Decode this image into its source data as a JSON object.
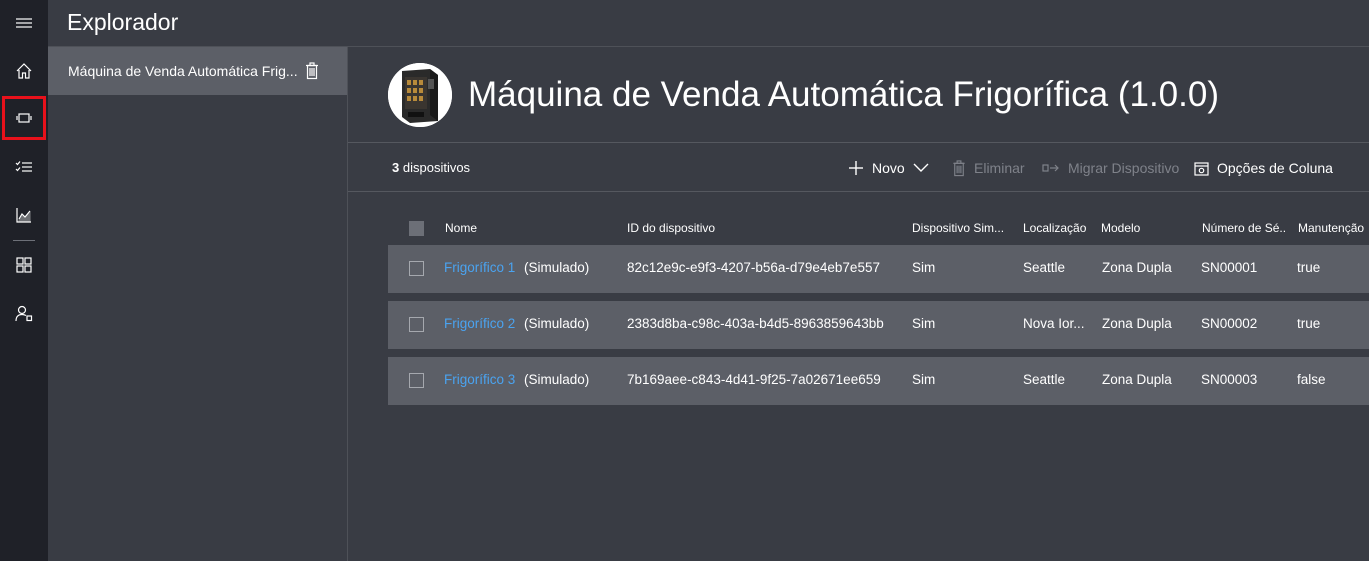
{
  "app": {
    "title": "Explorador"
  },
  "rail": {
    "items": [
      {
        "name": "hamburger-menu-icon"
      },
      {
        "name": "home-icon"
      },
      {
        "name": "devices-icon",
        "selected": true
      },
      {
        "name": "rules-icon"
      },
      {
        "name": "analytics-icon"
      },
      {
        "name": "dashboard-icon"
      },
      {
        "name": "admin-icon"
      }
    ]
  },
  "templates": {
    "items": [
      {
        "label": "Máquina de Venda Automática Frig...",
        "selected": true
      }
    ]
  },
  "header": {
    "title": "Máquina de Venda Automática Frigorífica (1.0.0)"
  },
  "toolbar": {
    "count_number": "3",
    "count_label": "dispositivos",
    "new_label": "Novo",
    "delete_label": "Eliminar",
    "migrate_label": "Migrar Dispositivo",
    "columns_label": "Opções de Coluna"
  },
  "table": {
    "columns": [
      "Nome",
      "ID do dispositivo",
      "Dispositivo Sim...",
      "Localização",
      "Modelo",
      "Número de Sé...",
      "Manutenção"
    ],
    "rows": [
      {
        "name": "Frigorífico 1",
        "simulated": "(Simulado)",
        "id": "82c12e9c-e9f3-4207-b56a-d79e4eb7e557",
        "sim": "Sim",
        "location": "Seattle",
        "model": "Zona Dupla",
        "serial": "SN00001",
        "maintenance": "true"
      },
      {
        "name": "Frigorífico 2",
        "simulated": "(Simulado)",
        "id": "2383d8ba-c98c-403a-b4d5-8963859643bb",
        "sim": "Sim",
        "location": "Nova Ior...",
        "model": "Zona Dupla",
        "serial": "SN00002",
        "maintenance": "true"
      },
      {
        "name": "Frigorífico 3",
        "simulated": "(Simulado)",
        "id": "7b169aee-c843-4d41-9f25-7a02671ee659",
        "sim": "Sim",
        "location": "Seattle",
        "model": "Zona Dupla",
        "serial": "SN00003",
        "maintenance": "false"
      }
    ]
  },
  "colors": {
    "rail_bg": "#1f2128",
    "panel_bg": "#393c44",
    "row_bg": "#5c5f67",
    "link": "#4aa3f0",
    "selection_outline": "#e8111b"
  }
}
